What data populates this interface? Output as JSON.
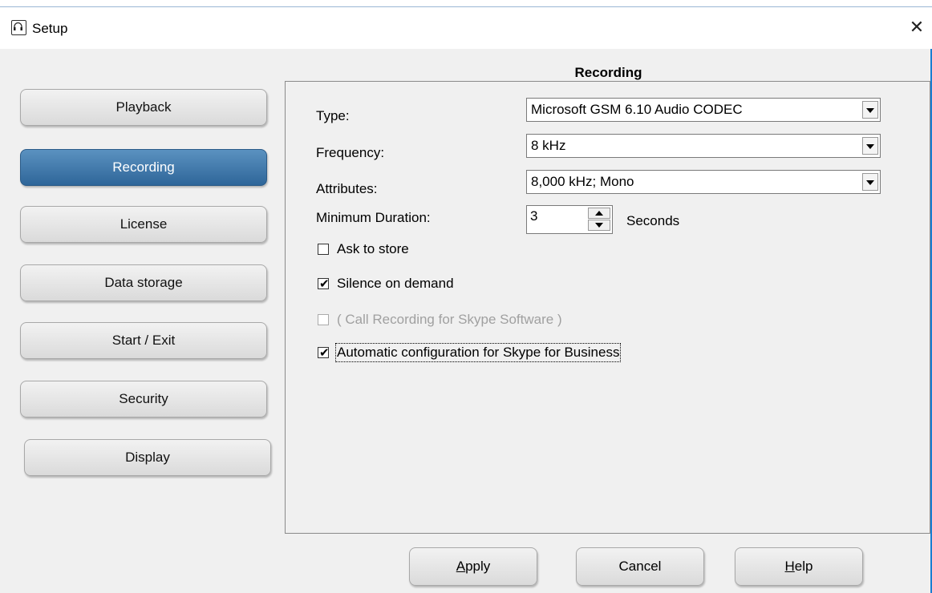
{
  "window": {
    "title": "Setup",
    "close_glyph": "✕",
    "app_icon": "headset-icon"
  },
  "nav": {
    "items": [
      {
        "label": "Playback",
        "active": false
      },
      {
        "label": "Recording",
        "active": true
      },
      {
        "label": "License",
        "active": false
      },
      {
        "label": "Data storage",
        "active": false
      },
      {
        "label": "Start / Exit",
        "active": false
      },
      {
        "label": "Security",
        "active": false
      },
      {
        "label": "Display",
        "active": false
      }
    ],
    "active_color": "#3a74a8"
  },
  "section": {
    "title": "Recording"
  },
  "form": {
    "type_label": "Type:",
    "type_value": "Microsoft GSM 6.10 Audio CODEC",
    "frequency_label": "Frequency:",
    "frequency_value": "8 kHz",
    "attributes_label": "Attributes:",
    "attributes_value": "8,000 kHz; Mono",
    "min_duration_label": "Minimum Duration:",
    "min_duration_value": "3",
    "min_duration_unit": "Seconds"
  },
  "checkboxes": [
    {
      "label": "Ask to store",
      "checked": false,
      "enabled": true
    },
    {
      "label": "Silence on demand",
      "checked": true,
      "enabled": true
    },
    {
      "label": "( Call Recording for Skype Software )",
      "checked": false,
      "enabled": false
    },
    {
      "label": "Automatic configuration for Skype for Business",
      "checked": true,
      "enabled": true,
      "focused": true
    }
  ],
  "buttons": {
    "apply": {
      "prefix": "",
      "mnemonic": "A",
      "rest": "pply"
    },
    "cancel": {
      "label": "Cancel"
    },
    "help": {
      "prefix": "",
      "mnemonic": "H",
      "rest": "elp"
    }
  }
}
